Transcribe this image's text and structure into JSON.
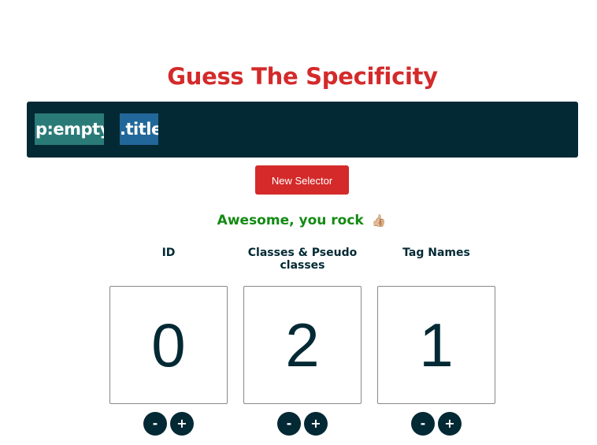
{
  "page": {
    "title": "Guess The Specificity"
  },
  "selector": {
    "tokens": [
      {
        "text": "p:empty",
        "kind": "pseudo-class",
        "color": "#2a7b78"
      },
      {
        "text": ".title",
        "kind": "class",
        "color": "#226799"
      }
    ],
    "bar_color": "#022934"
  },
  "new_selector_button": {
    "label": "New Selector",
    "color": "#d42a2a"
  },
  "feedback": {
    "message": "Awesome, you rock",
    "emoji": "👍🏼",
    "color": "#138a13"
  },
  "columns": [
    {
      "label": "ID",
      "value": "0",
      "minus_label": "-",
      "plus_label": "+"
    },
    {
      "label": "Classes & Pseudo classes",
      "value": "2",
      "minus_label": "-",
      "plus_label": "+"
    },
    {
      "label": "Tag Names",
      "value": "1",
      "minus_label": "-",
      "plus_label": "+"
    }
  ],
  "colors": {
    "accent": "#d42a2a",
    "dark": "#022934"
  }
}
